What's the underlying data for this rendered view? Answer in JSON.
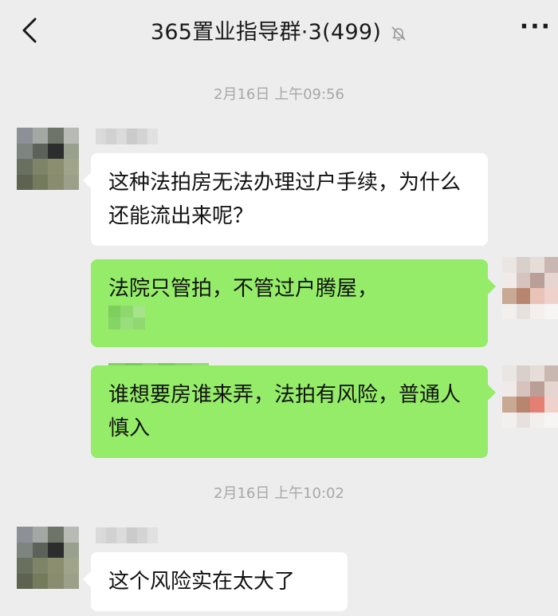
{
  "header": {
    "title": "365置业指导群·3(499)",
    "back_icon": "chevron-left-icon",
    "mute_icon": "bell-off-icon",
    "more_label": "···"
  },
  "messages": {
    "time_1": "2月16日 上午09:56",
    "msg_1": "这种法拍房无法办理过户手续，为什么还能流出来呢？",
    "msg_2_text": "法院只管拍，不管过户腾屋，",
    "msg_3": "谁想要房谁来弄，法拍有风险，普通人慎入",
    "time_2": "2月16日 上午10:02",
    "msg_4": "这个风险实在太大了"
  },
  "colors": {
    "background": "#ededed",
    "incoming_bubble": "#ffffff",
    "outgoing_bubble": "#95ec69",
    "timestamp": "#a8a8a8"
  }
}
